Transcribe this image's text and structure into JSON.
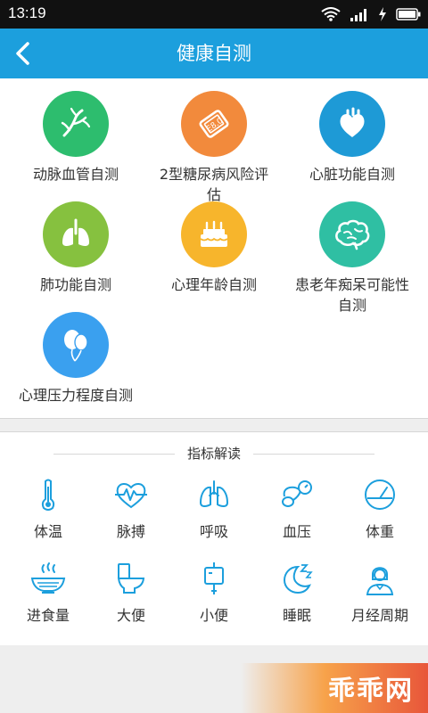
{
  "status_bar": {
    "time": "13:19"
  },
  "header": {
    "title": "健康自测",
    "back_icon": "chevron-left-icon"
  },
  "self_tests": [
    {
      "label": "动脉血管自测",
      "color": "#2dbd6e",
      "icon": "artery-icon"
    },
    {
      "label": "2型糖尿病风险评估",
      "color": "#f28a3c",
      "icon": "glucose-meter-icon"
    },
    {
      "label": "心脏功能自测",
      "color": "#1e9ad6",
      "icon": "heart-icon"
    },
    {
      "label": "肺功能自测",
      "color": "#86c13f",
      "icon": "lungs-icon"
    },
    {
      "label": "心理年龄自测",
      "color": "#f7b52c",
      "icon": "birthday-cake-icon"
    },
    {
      "label": "患老年痴呆可能性自测",
      "color": "#2fbfa3",
      "icon": "brain-icon"
    },
    {
      "label": "心理压力程度自测",
      "color": "#3aa0ef",
      "icon": "balloons-icon"
    }
  ],
  "index_section": {
    "title": "指标解读",
    "items": [
      {
        "label": "体温",
        "icon": "thermometer-icon"
      },
      {
        "label": "脉搏",
        "icon": "pulse-heart-icon"
      },
      {
        "label": "呼吸",
        "icon": "lungs-icon"
      },
      {
        "label": "血压",
        "icon": "blood-pressure-icon"
      },
      {
        "label": "体重",
        "icon": "scale-icon"
      },
      {
        "label": "进食量",
        "icon": "food-bowl-icon"
      },
      {
        "label": "大便",
        "icon": "toilet-icon"
      },
      {
        "label": "小便",
        "icon": "urine-bag-icon"
      },
      {
        "label": "睡眠",
        "icon": "moon-sleep-icon"
      },
      {
        "label": "月经周期",
        "icon": "woman-icon"
      }
    ]
  },
  "watermark": {
    "text": "乖乖网"
  },
  "colors": {
    "primary": "#1c9fdd",
    "icon_stroke": "#1c9fdd"
  }
}
